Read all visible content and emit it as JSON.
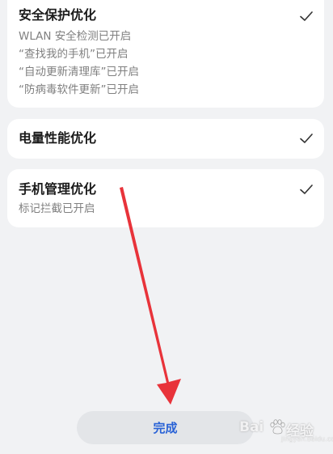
{
  "cards": [
    {
      "title": "安全保护优化",
      "details": [
        "WLAN 安全检测已开启",
        "“查找我的手机”已开启",
        "“自动更新清理库”已开启",
        "“防病毒软件更新”已开启"
      ],
      "checked": true
    },
    {
      "title": "电量性能优化",
      "details": [],
      "checked": true
    },
    {
      "title": "手机管理优化",
      "details": [
        "标记拦截已开启"
      ],
      "checked": true
    }
  ],
  "done_button": {
    "label": "完成"
  },
  "annotation": {
    "arrow_color": "#e8333a"
  },
  "watermark": {
    "left": "Bai",
    "right": "经验",
    "url": "jingyan.baidu.com"
  },
  "colors": {
    "background": "#f1f2f4",
    "card": "#ffffff",
    "accent": "#2a63d6",
    "secondary_text": "#808080"
  }
}
